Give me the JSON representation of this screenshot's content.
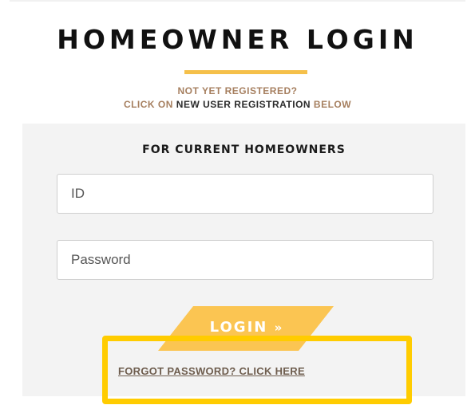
{
  "header": {
    "title": "HOMEOWNER LOGIN",
    "notice_line_1": "NOT YET REGISTERED?",
    "notice_prefix": "CLICK ON ",
    "notice_emphasis": "NEW USER REGISTRATION",
    "notice_suffix": " BELOW"
  },
  "login_panel": {
    "heading": "FOR CURRENT HOMEOWNERS",
    "id_field": {
      "placeholder": "ID",
      "value": ""
    },
    "password_field": {
      "placeholder": "Password",
      "value": ""
    },
    "login_button": {
      "label": "LOGIN",
      "arrow": "»"
    },
    "forgot_link": "FORGOT PASSWORD? CLICK HERE"
  },
  "colors": {
    "accent_yellow": "#fbc552",
    "highlight_yellow": "#ffcc00",
    "notice_brown": "#a67f5f",
    "panel_background": "#f3f3f3"
  }
}
